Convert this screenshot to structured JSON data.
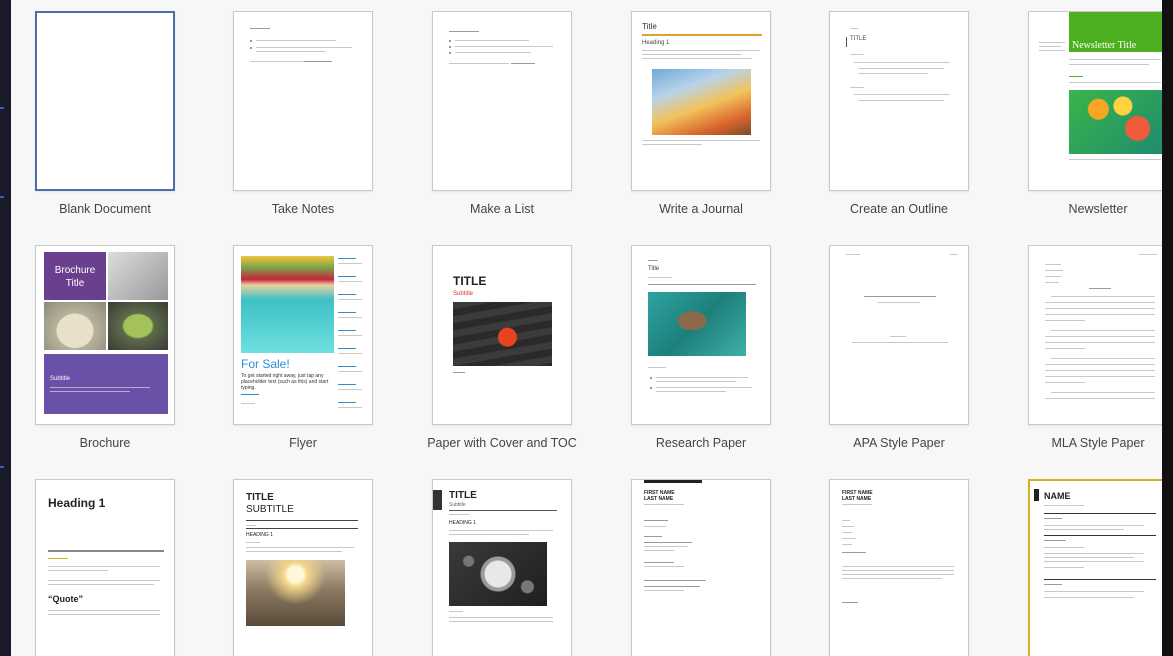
{
  "templates": [
    {
      "label": "Blank Document"
    },
    {
      "label": "Take Notes"
    },
    {
      "label": "Make a List"
    },
    {
      "label": "Write a Journal"
    },
    {
      "label": "Create an Outline"
    },
    {
      "label": "Newsletter"
    },
    {
      "label": "Brochure"
    },
    {
      "label": "Flyer"
    },
    {
      "label": "Paper with Cover and TOC"
    },
    {
      "label": "Research Paper"
    },
    {
      "label": "APA Style Paper"
    },
    {
      "label": "MLA Style Paper"
    },
    {
      "label": ""
    },
    {
      "label": ""
    },
    {
      "label": ""
    },
    {
      "label": ""
    },
    {
      "label": ""
    },
    {
      "label": ""
    }
  ],
  "thumb_text": {
    "journal_title": "Title",
    "journal_heading": "Heading 1",
    "outline_title": "TITLE",
    "newsletter_title": "Newsletter Title",
    "brochure_title": "Brochure Title",
    "brochure_subtitle": "Subtitle",
    "flyer_headline": "For Sale!",
    "flyer_body": "To get started right away, just tap any placeholder text (such as this) and start typing.",
    "cover_title": "TITLE",
    "cover_subtitle": "Subtitle",
    "research_title": "Title",
    "report_heading": "Heading 1",
    "report_quote": "“Quote”",
    "study_title": "TITLE",
    "study_subtitle": "SUBTITLE",
    "study_heading": "HEADING 1",
    "toc_title": "TITLE",
    "toc_subtitle": "Subtitle",
    "toc_heading": "HEADING 1",
    "resume_first": "FIRST NAME",
    "resume_last": "LAST NAME",
    "resume_name": "NAME"
  },
  "colors": {
    "accent": "#4a6ea9",
    "newsletter_green": "#4caf1f",
    "brochure_purple": "#6a3f8e",
    "flyer_blue": "#2a8fd6",
    "cover_red": "#d9362b",
    "resume_gold": "#d4b21f"
  }
}
